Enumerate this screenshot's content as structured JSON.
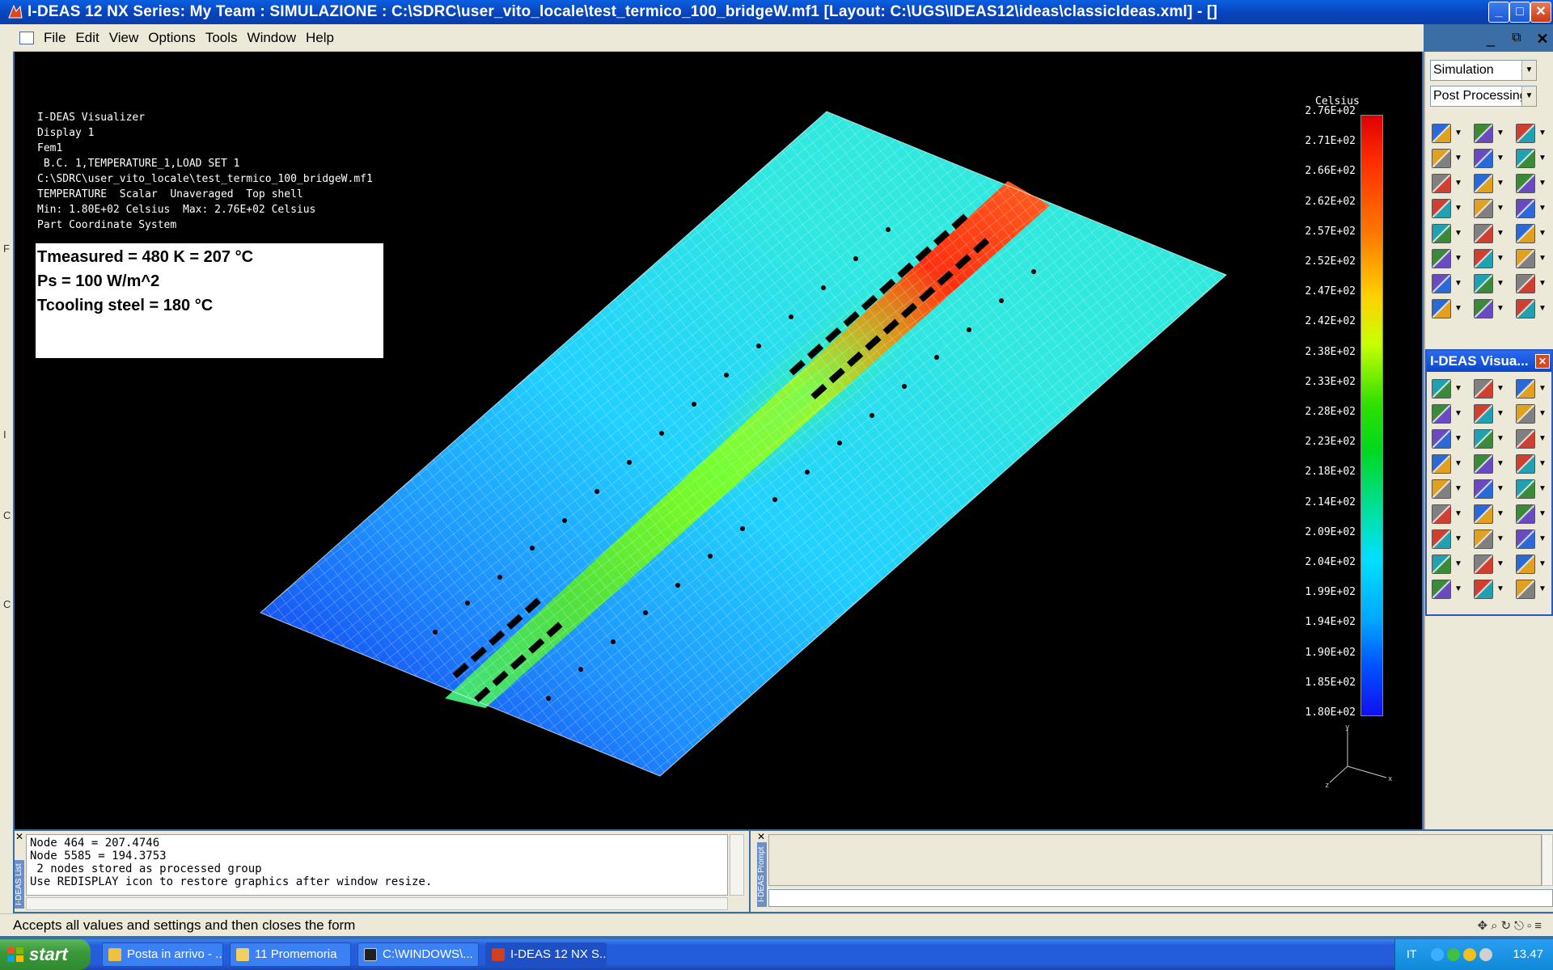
{
  "window": {
    "title": "I-DEAS 12 NX Series:     My Team : SIMULAZIONE : C:\\SDRC\\user_vito_locale\\test_termico_100_bridgeW.mf1    [Layout: C:\\UGS\\IDEAS12\\ideas\\classicIdeas.xml]     - []",
    "app_icon": "ideas-app-icon"
  },
  "menu": [
    "File",
    "Edit",
    "View",
    "Options",
    "Tools",
    "Window",
    "Help"
  ],
  "viewport": {
    "info_lines": [
      "I-DEAS Visualizer",
      "Display 1",
      "Fem1",
      " B.C. 1,TEMPERATURE_1,LOAD SET 1",
      "C:\\SDRC\\user_vito_locale\\test_termico_100_bridgeW.mf1",
      "TEMPERATURE  Scalar  Unaveraged  Top shell",
      "Min: 1.80E+02 Celsius  Max: 2.76E+02 Celsius",
      "Part Coordinate System"
    ],
    "note_lines": [
      "Tmeasured = 480 K = 207 °C",
      "Ps = 100 W/m^2",
      "Tcooling steel = 180 °C"
    ],
    "legend": {
      "unit": "Celsius",
      "ticks": [
        "2.76E+02",
        "2.71E+02",
        "2.66E+02",
        "2.62E+02",
        "2.57E+02",
        "2.52E+02",
        "2.47E+02",
        "2.42E+02",
        "2.38E+02",
        "2.33E+02",
        "2.28E+02",
        "2.23E+02",
        "2.18E+02",
        "2.14E+02",
        "2.09E+02",
        "2.04E+02",
        "1.99E+02",
        "1.94E+02",
        "1.90E+02",
        "1.85E+02",
        "1.80E+02"
      ]
    },
    "triad_axes": [
      "y",
      "x",
      "z"
    ]
  },
  "right_panel": {
    "task_combo": "Simulation",
    "mode_combo": "Post Processing",
    "visualizer_title": "I-DEAS Visua..."
  },
  "list_pane": {
    "label": "I-DEAS List",
    "lines": [
      "Node 464 = 207.4746",
      "Node 5585 = 194.3753",
      " 2 nodes stored as processed group",
      "Use REDISPLAY icon to restore graphics after window resize."
    ]
  },
  "prompt_pane": {
    "label": "I-DEAS Prompt"
  },
  "status": {
    "text": "Accepts all values and settings and then closes the form"
  },
  "taskbar": {
    "start": "start",
    "tasks": [
      {
        "label": "Posta in arrivo - ...",
        "icon": "mail-icon",
        "color": "#f0c040"
      },
      {
        "label": "11 Promemoria",
        "icon": "reminder-bell-icon",
        "color": "#f0d060"
      },
      {
        "label": "C:\\WINDOWS\\...",
        "icon": "cmd-icon",
        "color": "#202020"
      },
      {
        "label": "I-DEAS 12 NX S...",
        "icon": "ideas-app-icon",
        "color": "#d04020"
      }
    ],
    "tray_lang": "IT",
    "clock": "13.47"
  }
}
